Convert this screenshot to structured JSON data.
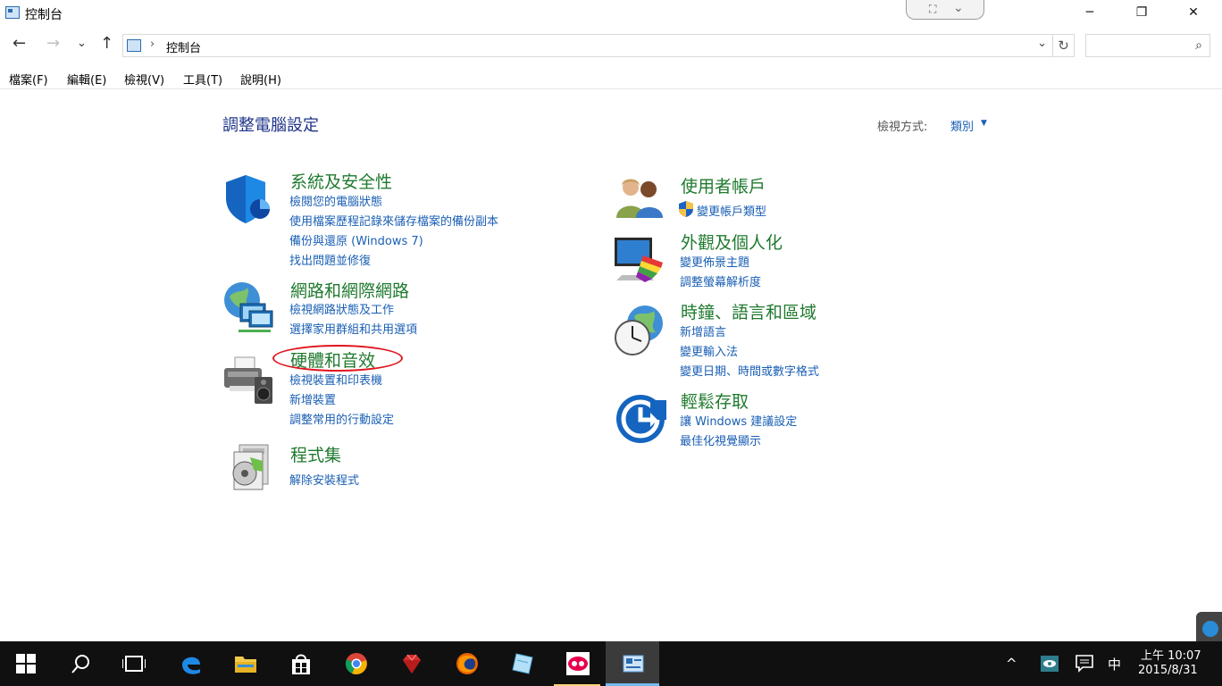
{
  "window": {
    "title": "控制台",
    "controls": {
      "minimize": "─",
      "restore": "❐",
      "close": "✕"
    }
  },
  "nav": {
    "back": "←",
    "forward": "→",
    "recent": "⌄",
    "up": "↑",
    "address_sep": "›",
    "address_text": "控制台",
    "dropdown": "⌄",
    "refresh": "↻",
    "search_placeholder": ""
  },
  "menu": [
    "檔案(F)",
    "編輯(E)",
    "檢視(V)",
    "工具(T)",
    "說明(H)"
  ],
  "page": {
    "title": "調整電腦設定",
    "view_by_label": "檢視方式:",
    "view_by_value": "類別"
  },
  "categories": [
    {
      "title": "系統及安全性",
      "icon": "shield-icon",
      "links": [
        "檢閱您的電腦狀態",
        "使用檔案歷程記錄來儲存檔案的備份副本",
        "備份與還原 (Windows 7)",
        "找出問題並修復"
      ]
    },
    {
      "title": "網路和網際網路",
      "icon": "network-globe-icon",
      "links": [
        "檢視網路狀態及工作",
        "選擇家用群組和共用選項"
      ]
    },
    {
      "title": "硬體和音效",
      "icon": "printer-speaker-icon",
      "links": [
        "檢視裝置和印表機",
        "新增裝置",
        "調整常用的行動設定"
      ]
    },
    {
      "title": "程式集",
      "icon": "programs-disc-icon",
      "links": [
        "解除安裝程式"
      ]
    },
    {
      "title": "使用者帳戶",
      "icon": "users-icon",
      "links": [
        "變更帳戶類型"
      ]
    },
    {
      "title": "外觀及個人化",
      "icon": "monitor-palette-icon",
      "links": [
        "變更佈景主題",
        "調整螢幕解析度"
      ]
    },
    {
      "title": "時鐘、語言和區域",
      "icon": "clock-globe-icon",
      "links": [
        "新增語言",
        "變更輸入法",
        "變更日期、時間或數字格式"
      ]
    },
    {
      "title": "輕鬆存取",
      "icon": "ease-of-access-icon",
      "links": [
        "讓 Windows 建議設定",
        "最佳化視覺顯示"
      ]
    }
  ],
  "taskbar": {
    "clock_time": "上午 10:07",
    "clock_date": "2015/8/31",
    "ime": "中",
    "tray_up": "^"
  },
  "colors": {
    "category_title": "#1f7a2e",
    "link": "#1a5fb4",
    "page_title": "#1e3287",
    "highlight": "#e0141e",
    "taskbar": "#101010"
  }
}
